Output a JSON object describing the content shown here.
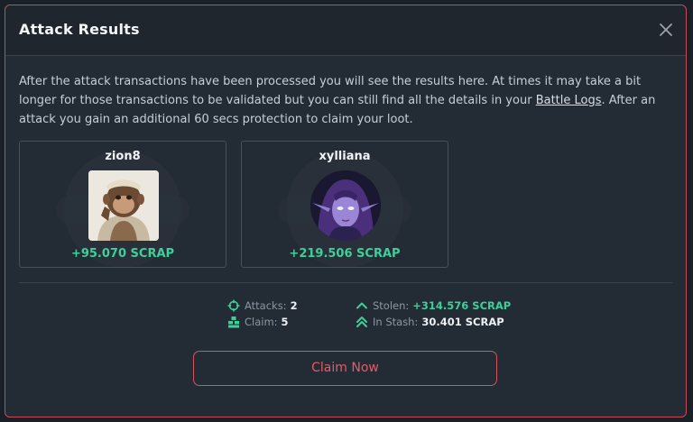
{
  "modal": {
    "title": "Attack Results",
    "intro_before": "After the attack transactions have been processed you will see the results here. At times it may take a bit longer for those transactions to be validated but you can still find all the details in your ",
    "intro_link": "Battle Logs",
    "intro_after": ". After an attack you gain an additional 60 secs protection to claim your loot."
  },
  "results": [
    {
      "name": "zion8",
      "reward": "+95.070 SCRAP",
      "avatar": "monkey-avatar"
    },
    {
      "name": "xylliana",
      "reward": "+219.506 SCRAP",
      "avatar": "elf-avatar"
    }
  ],
  "stats": {
    "attacks_label": "Attacks:",
    "attacks_value": "2",
    "claim_label": "Claim:",
    "claim_value": "5",
    "stolen_label": "Stolen:",
    "stolen_value": "+314.576 SCRAP",
    "stash_label": "In Stash:",
    "stash_value": "30.401 SCRAP"
  },
  "claim_button": "Claim Now",
  "colors": {
    "accent_red": "#d9515c",
    "reward_green": "#3fcf9a",
    "stats_teal": "#3fcf9a",
    "panel_bg": "#232b34"
  }
}
